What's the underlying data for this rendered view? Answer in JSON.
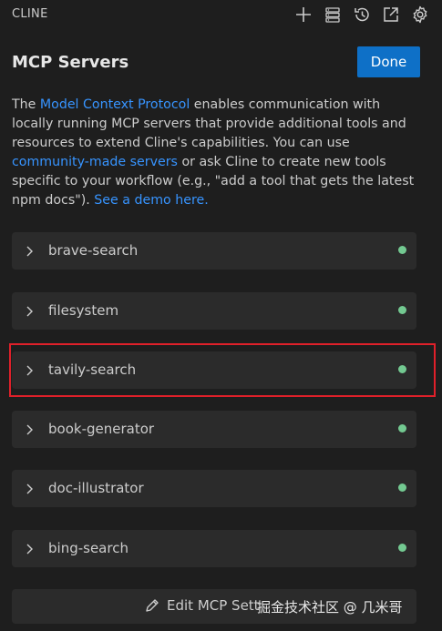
{
  "app": {
    "title": "CLINE"
  },
  "toolbar": {
    "icons": [
      "plus-icon",
      "server-icon",
      "history-icon",
      "popout-icon",
      "gear-icon"
    ]
  },
  "header": {
    "title": "MCP Servers",
    "done_label": "Done"
  },
  "description": {
    "part1": "The ",
    "link1": "Model Context Protocol",
    "part2": " enables communication with locally running MCP servers that provide additional tools and resources to extend Cline's capabilities. You can use ",
    "link2": "community-made servers",
    "part3": " or ask Cline to create new tools specific to your workflow (e.g., \"add a tool that gets the latest npm docs\"). ",
    "link3": "See a demo here."
  },
  "servers": [
    {
      "name": "brave-search",
      "status": "running"
    },
    {
      "name": "filesystem",
      "status": "running"
    },
    {
      "name": "tavily-search",
      "status": "running",
      "highlighted": true
    },
    {
      "name": "book-generator",
      "status": "running"
    },
    {
      "name": "doc-illustrator",
      "status": "running"
    },
    {
      "name": "bing-search",
      "status": "running"
    }
  ],
  "footer": {
    "edit_settings_label": "Edit MCP Settings",
    "edit_settings_visible_text": "Edit MCP Sett",
    "watermark": "掘金技术社区 @ 几米哥"
  },
  "colors": {
    "background": "#1e1e1e",
    "accent": "#0e70c7",
    "link": "#3794ff",
    "status_running": "#73c991",
    "highlight": "#e0202a"
  }
}
